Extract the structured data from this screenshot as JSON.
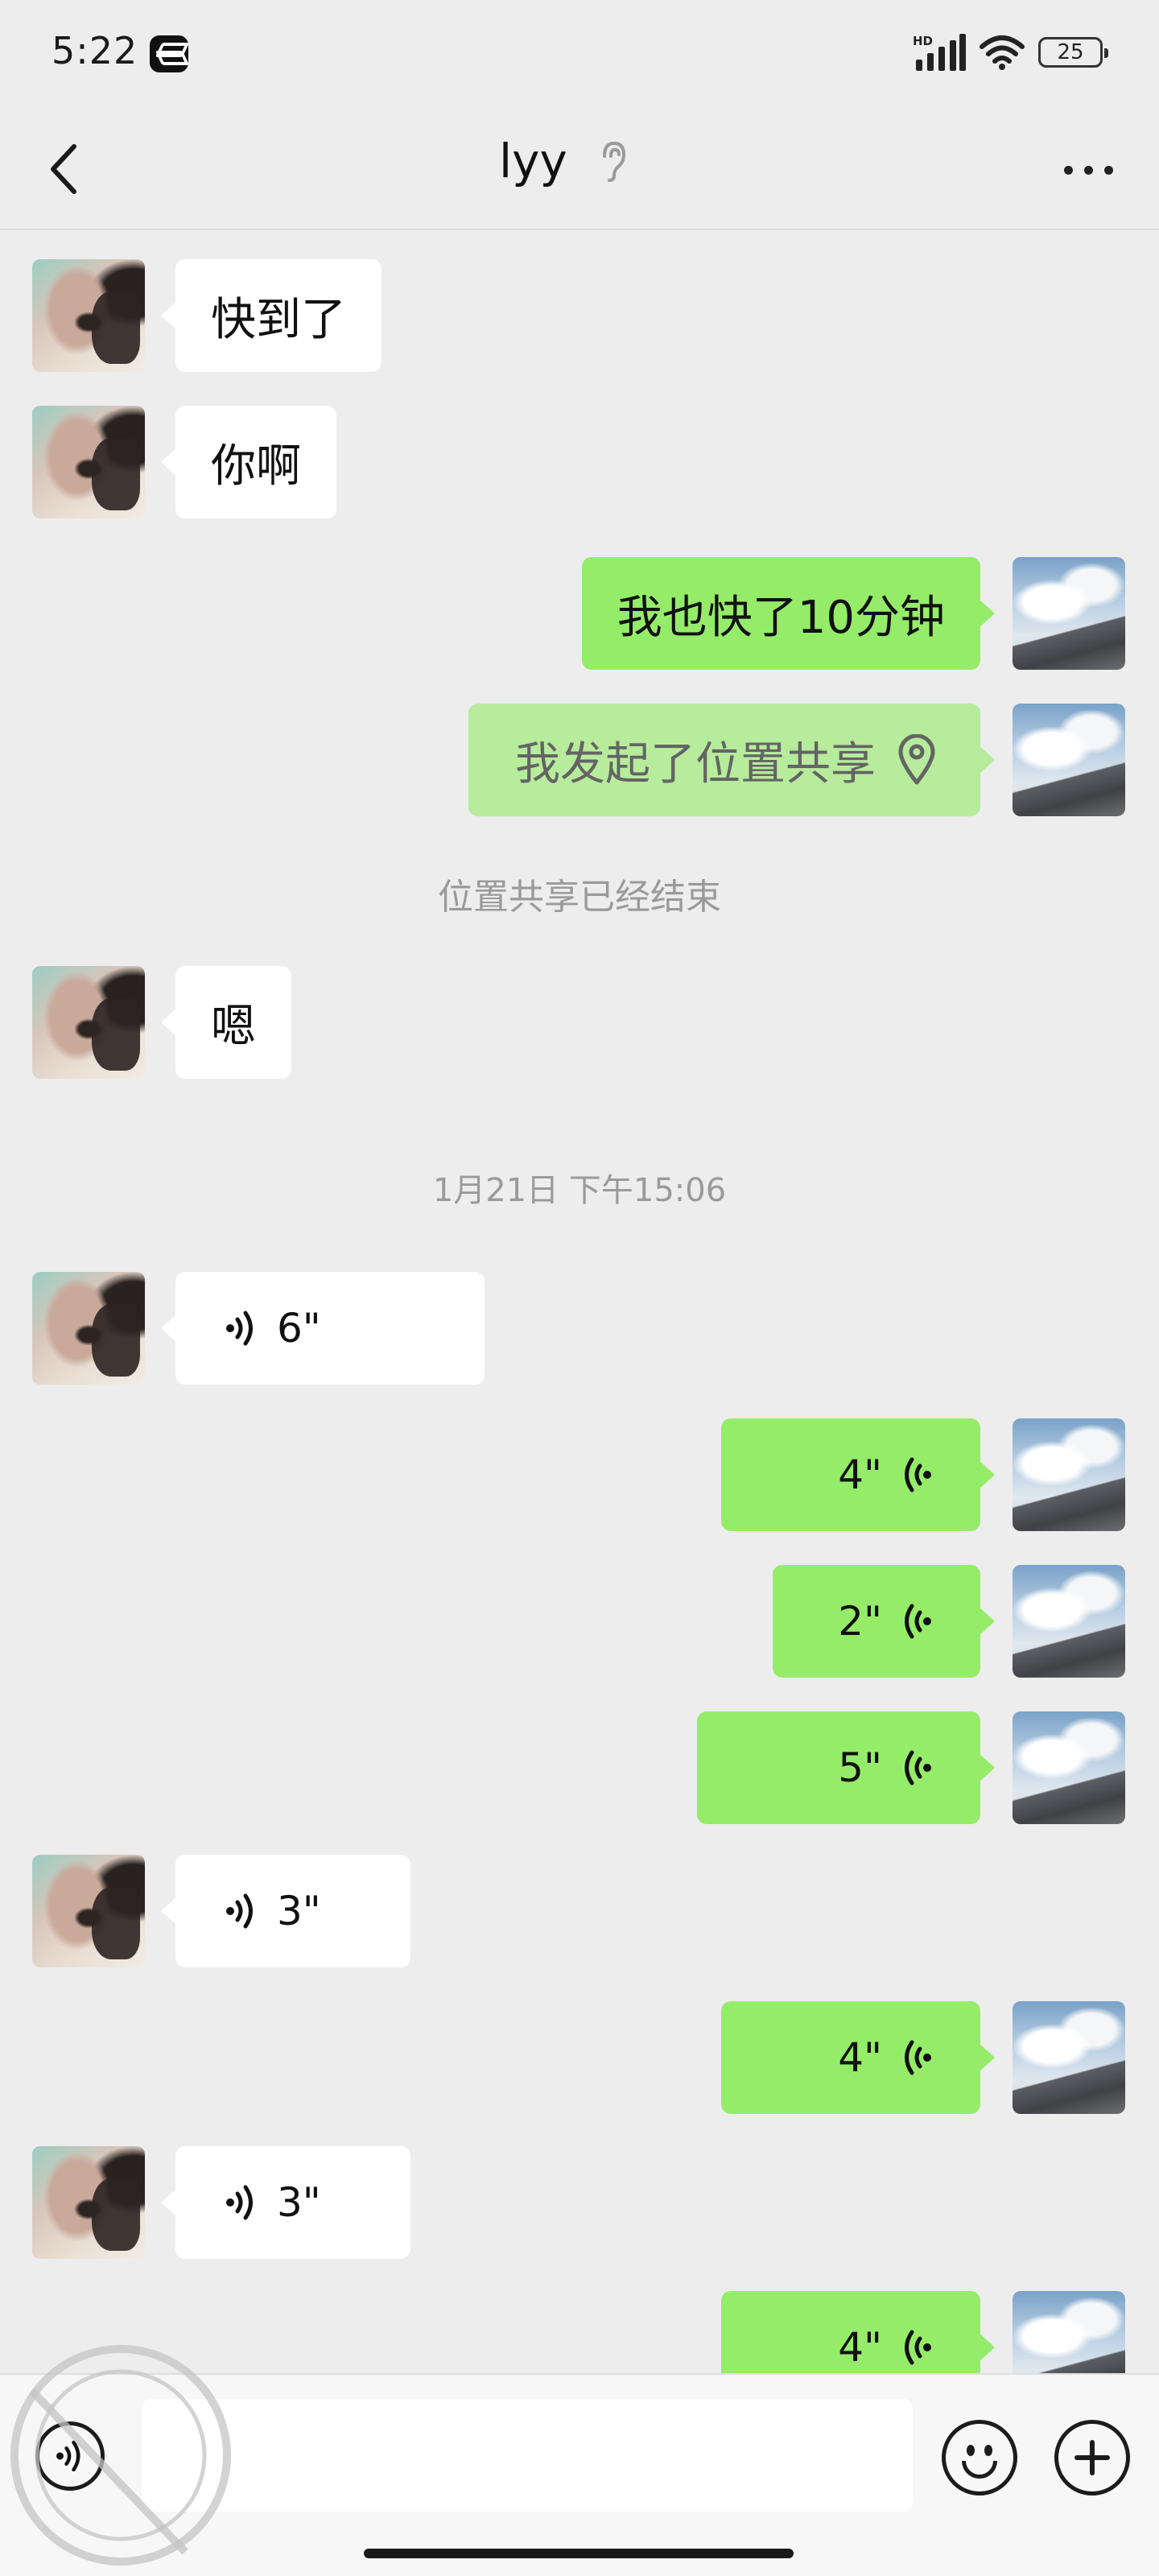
{
  "status_bar": {
    "time": "5:22",
    "battery": "25",
    "network": "HD"
  },
  "header": {
    "title": "lyy"
  },
  "messages": {
    "m1": "快到了",
    "m2": "你啊",
    "m3": "我也快了10分钟",
    "m4": "我发起了位置共享",
    "sys1": "位置共享已经结束",
    "m5": "嗯",
    "time1": "1月21日 下午15:06",
    "v1": "6\"",
    "v2": "4\"",
    "v3": "2\"",
    "v4": "5\"",
    "v5": "3\"",
    "v6": "4\"",
    "v7": "3\"",
    "v8": "4\""
  },
  "colors": {
    "background": "#ededed",
    "outgoing_bubble": "#95ec69",
    "incoming_bubble": "#ffffff",
    "system_text": "#9a9a9a"
  }
}
